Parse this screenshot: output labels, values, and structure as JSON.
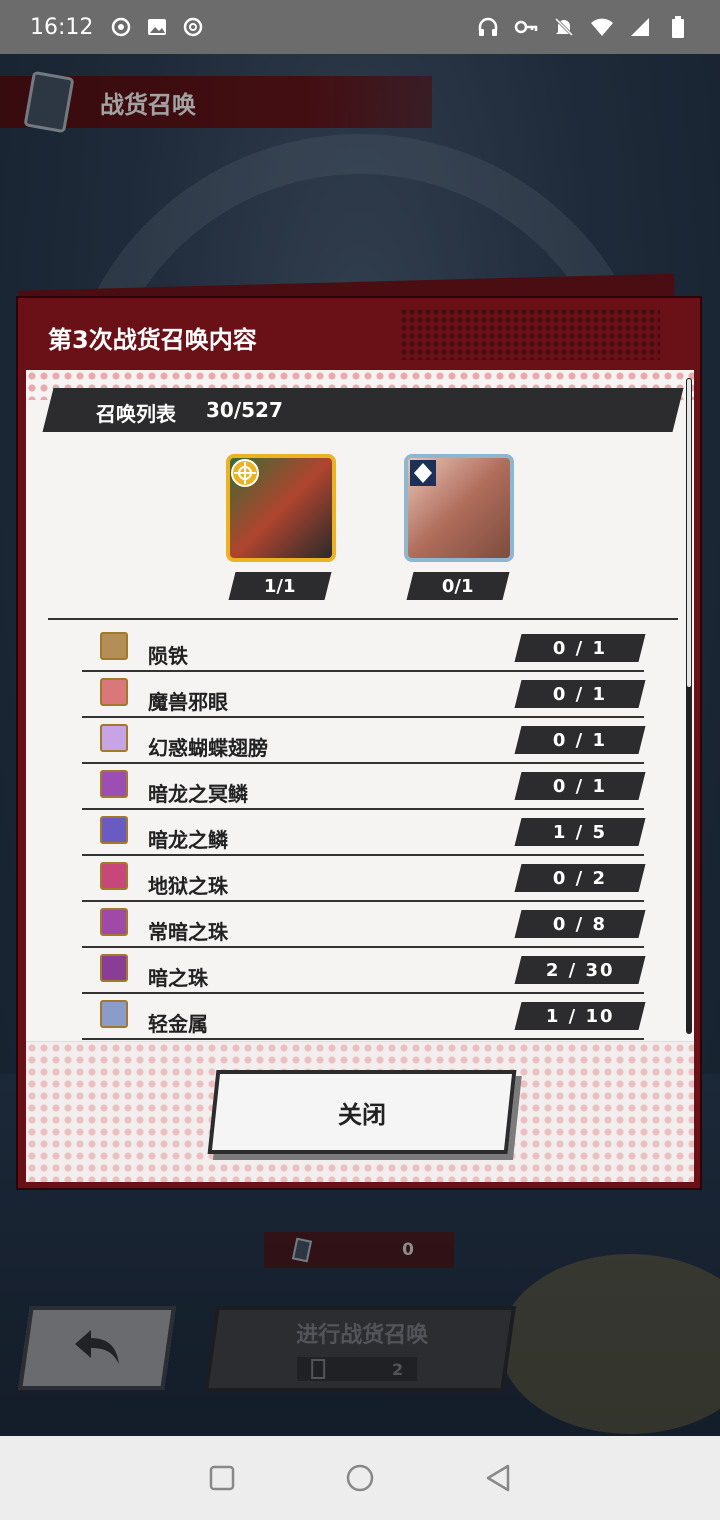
{
  "status_bar": {
    "time": "16:12"
  },
  "header": {
    "title": "战货召唤"
  },
  "dialog": {
    "title": "第3次战货召唤内容",
    "list_label": "召唤列表",
    "list_count": "30/527",
    "units": [
      {
        "count": "1/1"
      },
      {
        "count": "0/1"
      }
    ],
    "materials": [
      {
        "name": "陨铁",
        "count": "0 / 1",
        "icon": "meteor-iron-icon",
        "color": "#b38e56"
      },
      {
        "name": "魔兽邪眼",
        "count": "0 / 1",
        "icon": "beast-eye-icon",
        "color": "#d9777b"
      },
      {
        "name": "幻惑蝴蝶翅膀",
        "count": "0 / 1",
        "icon": "butterfly-wing-icon",
        "color": "#c6a4e5"
      },
      {
        "name": "暗龙之冥鳞",
        "count": "0 / 1",
        "icon": "dark-dragon-scale-icon",
        "color": "#9b4fb5"
      },
      {
        "name": "暗龙之鳞",
        "count": "1 / 5",
        "icon": "dragon-scale-icon",
        "color": "#6a5ac4"
      },
      {
        "name": "地狱之珠",
        "count": "0 / 2",
        "icon": "hell-orb-icon",
        "color": "#c8477a"
      },
      {
        "name": "常暗之珠",
        "count": "0 / 8",
        "icon": "eternal-dark-orb-icon",
        "color": "#a04aa8"
      },
      {
        "name": "暗之珠",
        "count": "2 / 30",
        "icon": "dark-orb-icon",
        "color": "#8a3d94"
      },
      {
        "name": "轻金属",
        "count": "1 / 10",
        "icon": "light-metal-icon",
        "color": "#8a9cc9"
      }
    ],
    "close_label": "关闭"
  },
  "footer": {
    "counter_value": "0",
    "summon_label": "进行战货召唤",
    "summon_cost": "2"
  }
}
